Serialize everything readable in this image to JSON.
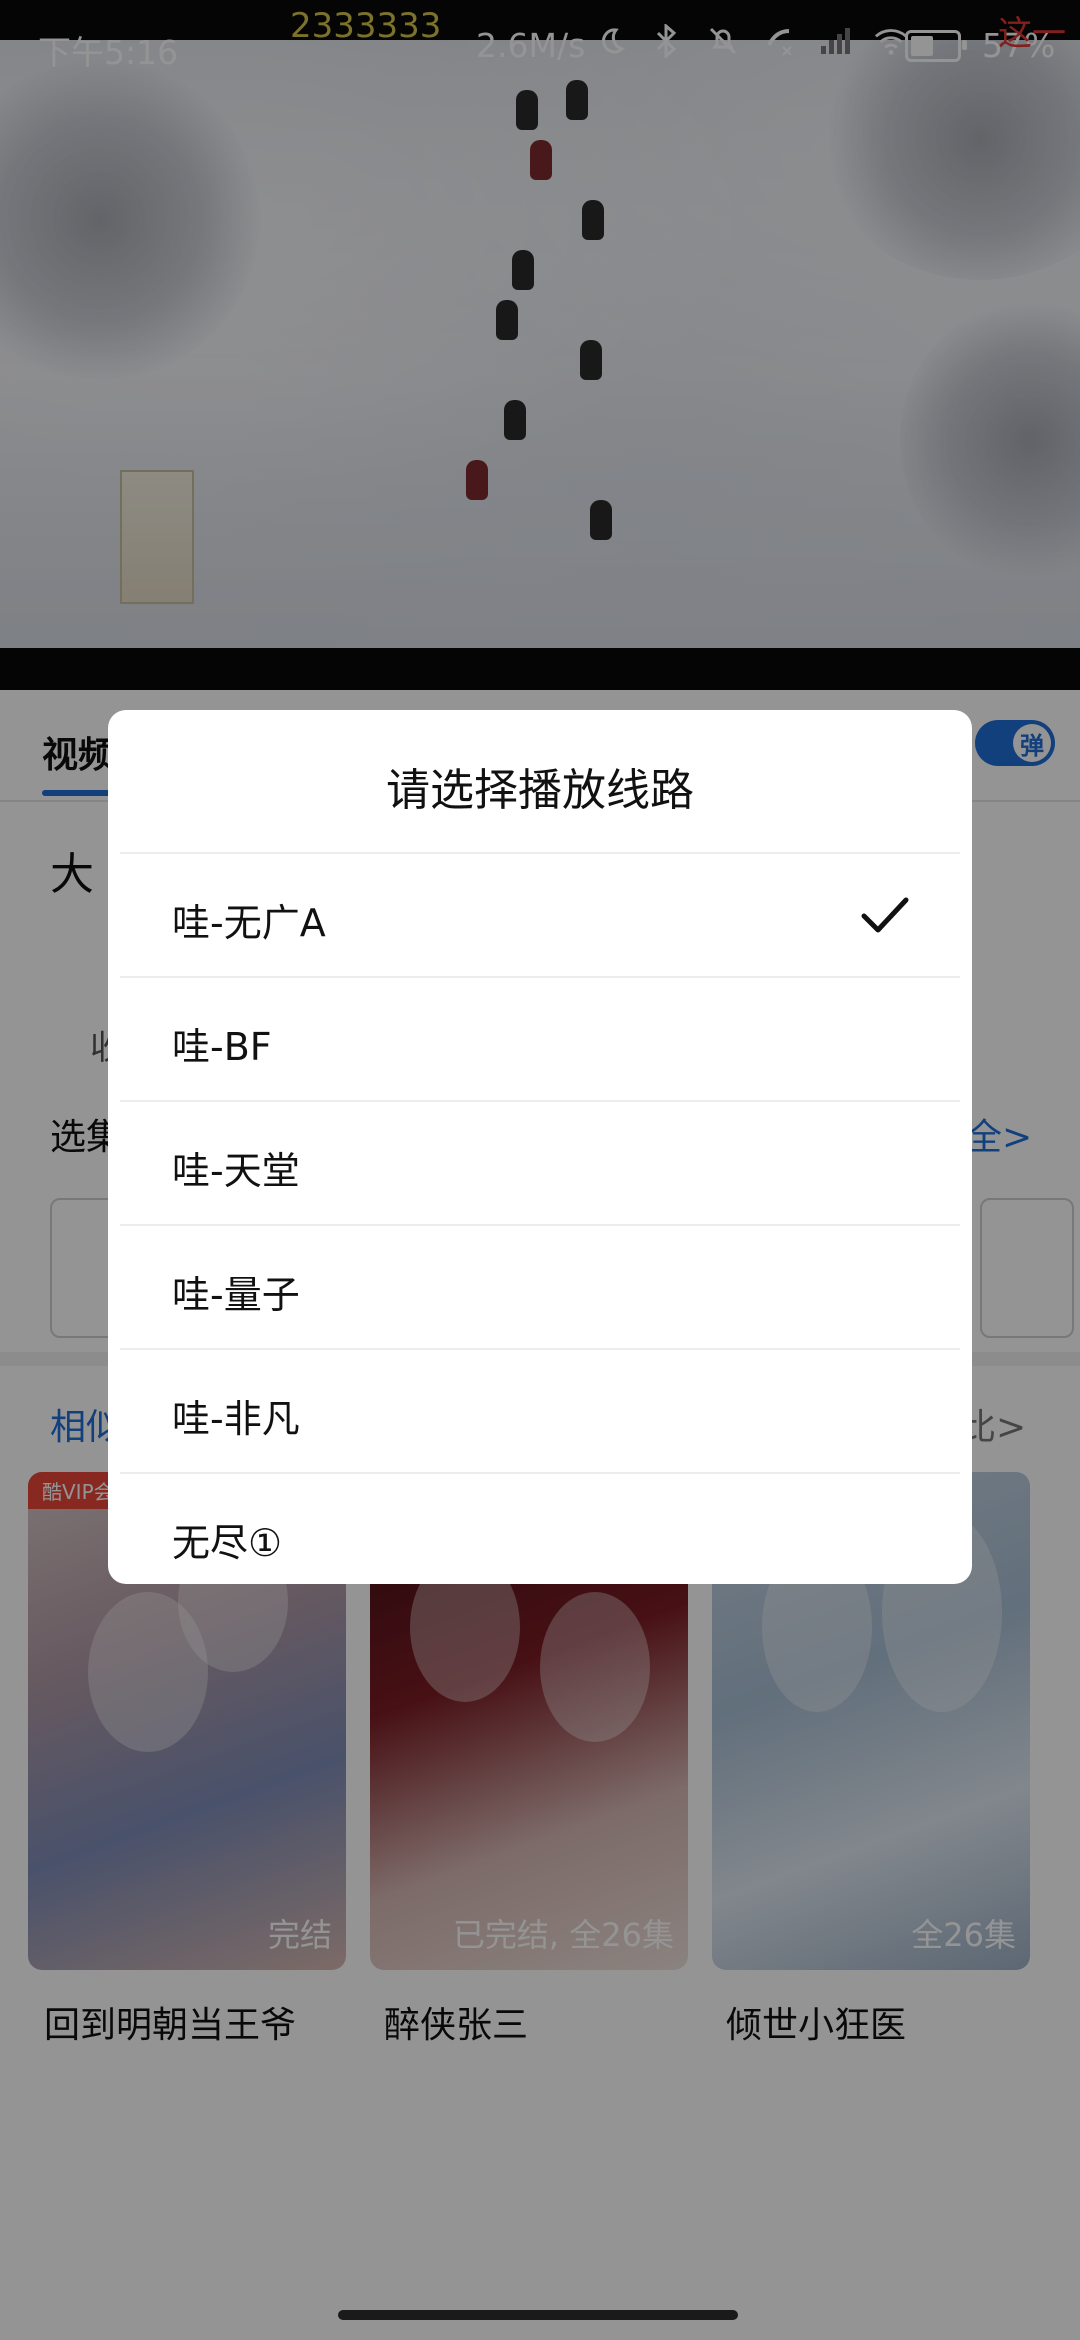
{
  "status_bar": {
    "time": "下午5:16",
    "net_speed": "2.6M/s",
    "battery_percent": "57%",
    "battery_level": 0.57,
    "icons": [
      "moon-icon",
      "bluetooth-icon",
      "bell-off-icon",
      "phone-icon",
      "signal-icon",
      "wifi-icon"
    ]
  },
  "player": {
    "danmaku_1": "2333333",
    "danmaku_2": "这一"
  },
  "page": {
    "tab_video": "视频",
    "danmaku_toggle": "弹",
    "title_partial": "大",
    "fav_partial": "收",
    "episodes_label": "选集",
    "episodes_more": "全>",
    "related_label": "相似",
    "related_more": "比>",
    "colors": {
      "accent": "#1f6fd8"
    },
    "posters": [
      {
        "title": "回到明朝当王爷",
        "badge": "完结",
        "vip": "酷VIP会员"
      },
      {
        "title": "醉侠张三",
        "badge": "已完结, 全26集",
        "vip": ""
      },
      {
        "title": "倾世小狂医",
        "badge": "全26集",
        "vip": ""
      }
    ]
  },
  "dialog": {
    "title": "请选择播放线路",
    "options": [
      {
        "label": "哇-无广A",
        "selected": true
      },
      {
        "label": "哇-BF",
        "selected": false
      },
      {
        "label": "哇-天堂",
        "selected": false
      },
      {
        "label": "哇-量子",
        "selected": false
      },
      {
        "label": "哇-非凡",
        "selected": false
      },
      {
        "label": "无尽①",
        "selected": false
      }
    ]
  }
}
